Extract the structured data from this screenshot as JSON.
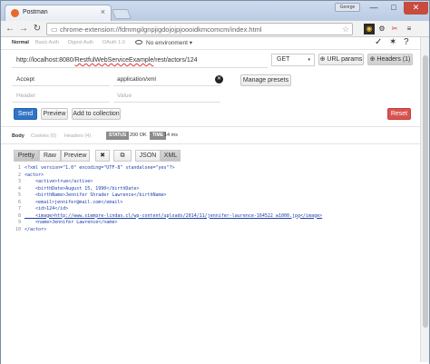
{
  "browser": {
    "tab_title": "Postman",
    "tab_close": "×",
    "user_badge": "George",
    "window_min": "—",
    "window_max": "□",
    "window_close": "✕",
    "back": "←",
    "forward": "→",
    "reload": "↻",
    "url": "chrome-extension://fdmmgilgnpjigdojojpjoooidkmcomcm/index.html",
    "star": "☆"
  },
  "postman": {
    "auth_tabs": [
      "Normal",
      "Basic Auth",
      "Digest Auth",
      "OAuth 1.0"
    ],
    "environment": "No environment ▾",
    "request_url_prefix": "http://localhost:8080/",
    "request_url_misspelled": "RestfulWebServiceExample",
    "request_url_suffix": "/rest/actors/124",
    "method": "GET",
    "method_caret": "▾",
    "url_params_label": "URL params",
    "headers_label": "Headers (1)",
    "headers": [
      {
        "key": "Accept",
        "value": "application/xml"
      }
    ],
    "header_key_placeholder": "Header",
    "header_value_placeholder": "Value",
    "manage_presets_label": "Manage presets",
    "send_label": "Send",
    "preview_label": "Preview",
    "add_collection_label": "Add to collection",
    "reset_label": "Reset",
    "response_tabs": [
      "Body",
      "Cookies (0)",
      "Headers (4)"
    ],
    "status_label": "STATUS",
    "status_value": "200 OK",
    "time_label": "TIME",
    "time_value": "14 ms",
    "view_buttons": [
      "Pretty",
      "Raw",
      "Preview"
    ],
    "format_buttons": [
      "JSON",
      "XML"
    ],
    "response_lines": [
      "<?xml version=\"1.0\" encoding=\"UTF-8\" standalone=\"yes\"?>",
      "<actor>",
      "    <active>true</active>",
      "    <birthDate>August 15, 1990</birthDate>",
      "    <birthName>Jennifer Shrader Lawrence</birthName>",
      "    <email>jennifer@mail.com</email>",
      "    <id>124</id>",
      "    <image>http://www.siempre-lindas.cl/wp-content/uploads/2014/11/jennifer-laurence-164522_w1000.jpg</image>",
      "    <name>Jennifer Lawrence</name>",
      "</actor>"
    ]
  }
}
